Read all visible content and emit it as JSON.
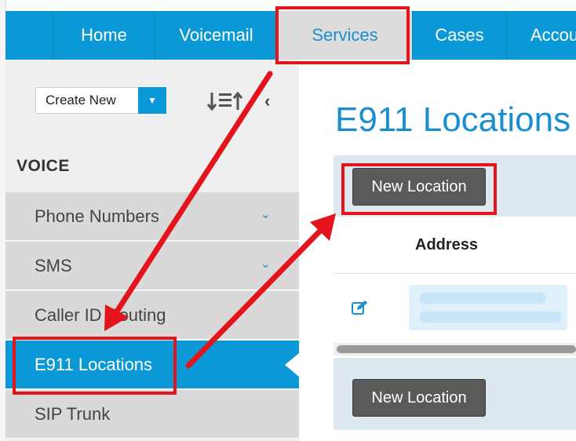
{
  "nav": {
    "tabs": [
      {
        "label": "Home"
      },
      {
        "label": "Voicemail"
      },
      {
        "label": "Services"
      },
      {
        "label": "Cases"
      },
      {
        "label": "Accou"
      }
    ],
    "active_tab": "Services"
  },
  "sidebar": {
    "create_new_label": "Create New",
    "section_title": "VOICE",
    "items": [
      {
        "label": "Phone Numbers",
        "expandable": true
      },
      {
        "label": "SMS",
        "expandable": true
      },
      {
        "label": "Caller ID Routing",
        "expandable": false
      },
      {
        "label": "E911 Locations",
        "expandable": false
      },
      {
        "label": "SIP Trunk",
        "expandable": false
      }
    ],
    "active_item": "E911 Locations"
  },
  "main": {
    "title": "E911 Locations",
    "new_location_label": "New Location",
    "table": {
      "columns": [
        "Address"
      ]
    }
  },
  "colors": {
    "brand_blue": "#0b98d6",
    "annotation_red": "#e3141b",
    "button_gray": "#5a5a5a",
    "toolbar_bg": "#dde9ef"
  },
  "icons": [
    "chevron-down-icon",
    "sort-icon",
    "chevron-left-icon",
    "edit-icon"
  ]
}
